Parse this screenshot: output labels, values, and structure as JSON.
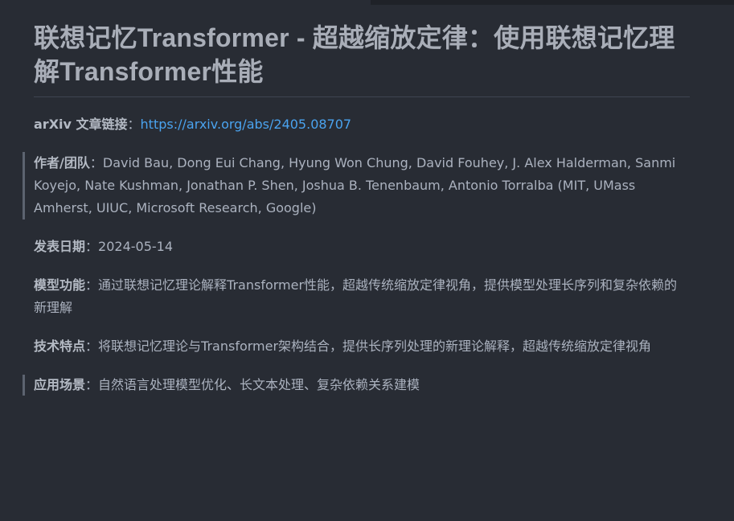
{
  "title": "联想记忆Transformer - 超越缩放定律：使用联想记忆理解Transformer性能",
  "link": {
    "label": "arXiv 文章链接",
    "separator": "：",
    "url": "https://arxiv.org/abs/2405.08707"
  },
  "authors": {
    "label": "作者/团队",
    "separator": "：",
    "value": "David Bau, Dong Eui Chang, Hyung Won Chung, David Fouhey, J. Alex Halderman, Sanmi Koyejo, Nate Kushman, Jonathan P. Shen, Joshua B. Tenenbaum, Antonio Torralba (MIT, UMass Amherst, UIUC, Microsoft Research, Google)"
  },
  "date": {
    "label": "发表日期",
    "separator": "：",
    "value": "2024-05-14"
  },
  "function": {
    "label": "模型功能",
    "separator": "：",
    "value": "通过联想记忆理论解释Transformer性能，超越传统缩放定律视角，提供模型处理长序列和复杂依赖的新理解"
  },
  "tech": {
    "label": "技术特点",
    "separator": "：",
    "value": "将联想记忆理论与Transformer架构结合，提供长序列处理的新理论解释，超越传统缩放定律视角"
  },
  "application": {
    "label": "应用场景",
    "separator": "：",
    "value": "自然语言处理模型优化、长文本处理、复杂依赖关系建模"
  },
  "colors": {
    "background": "#282c34",
    "text": "#abb2bf",
    "link": "#4aa3ef",
    "quote_bar": "#5c6370",
    "rule": "#3e4451"
  }
}
